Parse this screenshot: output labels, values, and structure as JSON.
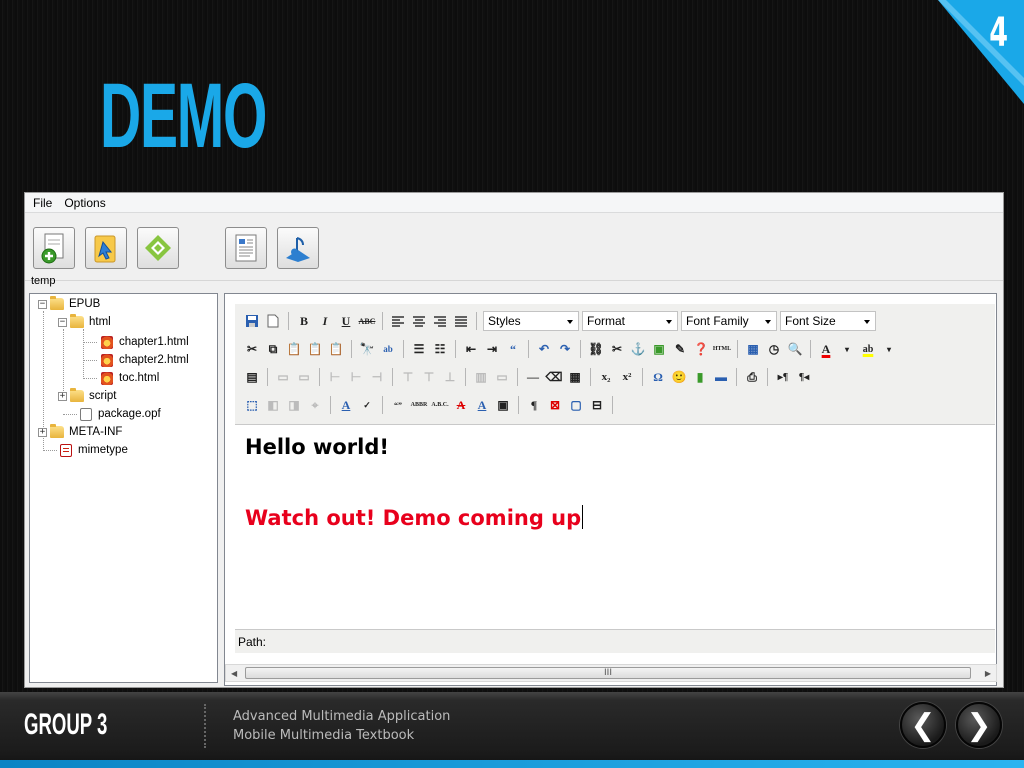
{
  "slide": {
    "page_number": "4",
    "title": "DEMO",
    "accent_color": "#1aa8e8"
  },
  "app": {
    "menu": [
      "File",
      "Options"
    ],
    "toolbar_icons": [
      "add-page-icon",
      "open-folder-icon",
      "epub-icon",
      "document-icon",
      "audio-icon"
    ],
    "temp_label": "temp",
    "tree": {
      "root": "EPUB",
      "html_folder": "html",
      "files": [
        "chapter1.html",
        "chapter2.html",
        "toc.html"
      ],
      "script_folder": "script",
      "package": "package.opf",
      "meta_inf": "META-INF",
      "mimetype": "mimetype"
    },
    "editor": {
      "selects": {
        "styles": "Styles",
        "format": "Format",
        "font_family": "Font Family",
        "font_size": "Font Size"
      },
      "content_line1": "Hello world!",
      "content_line2": "Watch out! Demo coming up",
      "content_line2_color": "#e8001c",
      "path_label": "Path:",
      "scroll_grip": "III"
    }
  },
  "footer": {
    "group": "GROUP 3",
    "line1": "Advanced Multimedia Application",
    "line2": "Mobile Multimedia Textbook",
    "prev": "❮",
    "next": "❯"
  }
}
